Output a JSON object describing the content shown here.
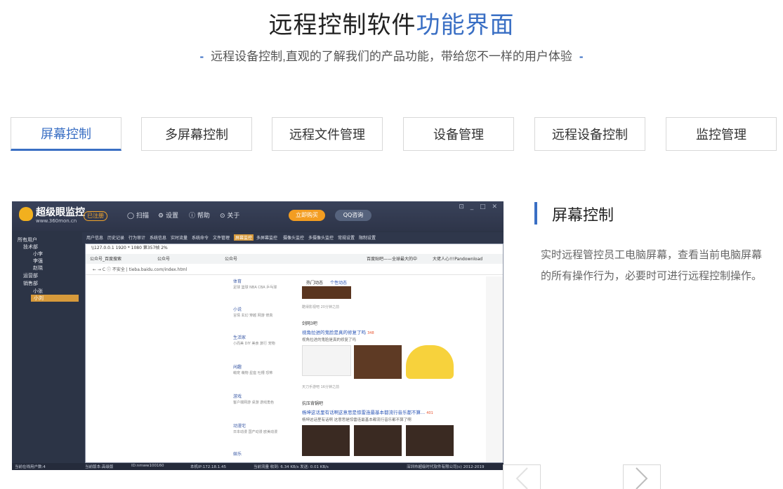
{
  "header": {
    "title_main": "远程控制软件",
    "title_accent": "功能界面",
    "subtitle": "远程设备控制,直观的了解我们的产品功能，带给您不一样的用户体验",
    "dash": "-"
  },
  "tabs": [
    {
      "label": "屏幕控制",
      "active": true
    },
    {
      "label": "多屏幕控制",
      "active": false
    },
    {
      "label": "远程文件管理",
      "active": false
    },
    {
      "label": "设备管理",
      "active": false
    },
    {
      "label": "远程设备控制",
      "active": false
    },
    {
      "label": "监控管理",
      "active": false
    }
  ],
  "screenshot": {
    "brand": "超级眼监控",
    "brand_url": "www.360mon.cn",
    "register": "已注册",
    "menu": [
      "扫描",
      "设置",
      "帮助",
      "关于"
    ],
    "buy": "立即购买",
    "qq": "QQ咨询",
    "window_controls": "⊡ _ □ ✕",
    "tree": [
      "所有用户",
      "技术部",
      "小李",
      "李强",
      "赵晓",
      "运营部",
      "销售部",
      "小张",
      "小刘"
    ],
    "nav": [
      "用户信息",
      "历史记录",
      "行为审计",
      "系统信息",
      "实时流量",
      "系统命令",
      "文件管理",
      "屏幕监控",
      "多屏幕监控",
      "摄像头监控",
      "多摄像头监控",
      "常规设置",
      "限制设置"
    ],
    "nav_active_index": 7,
    "browser_title": "\\\\127.0.0.1 1920 * 1080 第357帧 2%",
    "browser_tabs": [
      "公众号_百度搜索",
      "公众号",
      "公众号",
      "百度贴吧——全球最大的中",
      "大佬人心!!!Pandownload"
    ],
    "address": "不安全 | tieba.baidu.com/index.html",
    "menu_groups": [
      {
        "head": "体育",
        "sub": "足球 篮球 NBA CBA 乒乓球"
      },
      {
        "head": "小说",
        "sub": "言情 玄幻 穿越 网游 修真"
      },
      {
        "head": "生活家",
        "sub": "小而美 DIY 美食 旅行 宠物"
      },
      {
        "head": "闲趣",
        "sub": "萌宠 萌物 星座 吐槽 恐怖"
      },
      {
        "head": "游戏",
        "sub": "客户端网游 桌游 游戏角色"
      },
      {
        "head": "动漫宅",
        "sub": "日本动漫 国产动漫 欧美动漫"
      },
      {
        "head": "娱乐",
        "sub": ""
      }
    ],
    "feed_tabs": [
      "热门动态",
      "个性动态"
    ],
    "feed": {
      "meta1": "酷得影视吧  20分钟之前",
      "group1": "剑网3吧",
      "post1": "视角拉进的鬼脸是真的修复了吗",
      "post1_count": "348",
      "post1_desc": "视角拉进的鬼脸是真的修复了吗",
      "meta2": "天刀手游吧  16分钟之前",
      "group2": "抗压背锅吧",
      "post2": "杨坤这话里有话啊这意思是惊雷连最基本都流行音乐都不算...",
      "post2_count": "401",
      "post2_desc": "杨坤这话里有话啊 这意思是惊雷连最基本都流行音乐都不算了啊"
    },
    "status": [
      "当前在线用户数:4",
      "当前版本:高级版",
      "ID:nmww100160",
      "本机IP:172.18.1.45",
      "当前流量 收到: 6.34 KB/s   发送: 0.01 KB/s",
      "深圳市超级时代软件有限公司(c) 2012-2019"
    ]
  },
  "detail": {
    "title": "屏幕控制",
    "description": "实时远程管控员工电脑屏幕，查看当前电脑屏幕的所有操作行为，必要时可进行远程控制操作。"
  },
  "colors": {
    "accent": "#3a6fc4",
    "orange": "#d79a3b"
  },
  "icons": [
    "chevron-left-icon",
    "chevron-right-icon"
  ]
}
